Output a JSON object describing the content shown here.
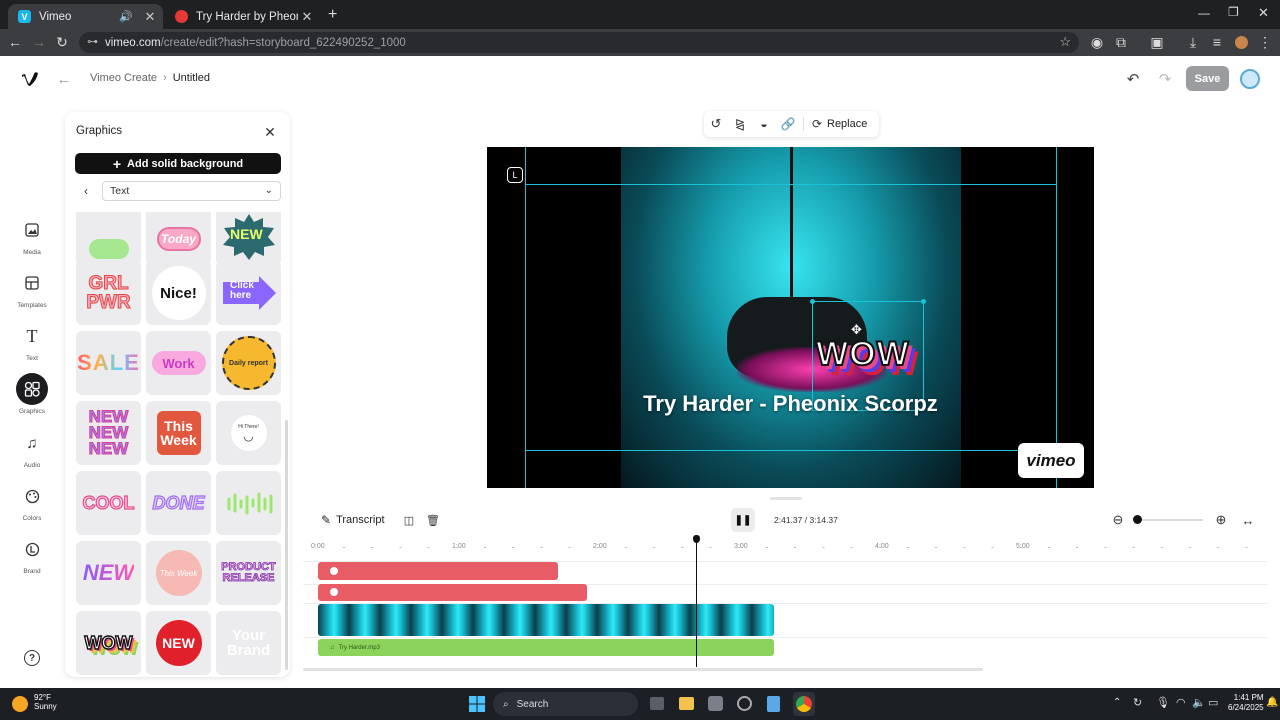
{
  "browser": {
    "tabs": [
      {
        "title": "Vimeo",
        "icon": "vimeo-favicon",
        "active": true
      },
      {
        "title": "Try Harder by Pheonix_Variety |",
        "icon": "youtube-favicon",
        "active": false
      }
    ],
    "url_host": "vimeo.com",
    "url_path": "/create/edit?hash=storyboard_622490252_1000"
  },
  "app": {
    "breadcrumb_root": "Vimeo Create",
    "breadcrumb_current": "Untitled",
    "save_label": "Save"
  },
  "rail": {
    "items": [
      {
        "label": "Media",
        "icon": "image-icon"
      },
      {
        "label": "Templates",
        "icon": "templates-icon"
      },
      {
        "label": "Text",
        "icon": "text-icon"
      },
      {
        "label": "Graphics",
        "icon": "graphics-icon",
        "active": true
      },
      {
        "label": "Audio",
        "icon": "music-note-icon"
      },
      {
        "label": "Colors",
        "icon": "palette-icon"
      },
      {
        "label": "Brand",
        "icon": "brand-icon"
      }
    ]
  },
  "panel": {
    "title": "Graphics",
    "add_bg_label": "Add solid background",
    "category": "Text",
    "stickers": [
      {
        "text": "",
        "name": "sticker-green-partial"
      },
      {
        "text": "Today",
        "name": "sticker-today"
      },
      {
        "text": "NEW",
        "name": "sticker-new-burst"
      },
      {
        "text": "GRL PWR",
        "name": "sticker-grl-pwr"
      },
      {
        "text": "Nice!",
        "name": "sticker-nice"
      },
      {
        "text": "Click here",
        "name": "sticker-click-here"
      },
      {
        "text": "SALE",
        "name": "sticker-sale"
      },
      {
        "text": "Work",
        "name": "sticker-work"
      },
      {
        "text": "Daily report",
        "name": "sticker-daily-report"
      },
      {
        "text": "NEW NEW NEW",
        "name": "sticker-new-new-new"
      },
      {
        "text": "This Week",
        "name": "sticker-this-week"
      },
      {
        "text": "Hi There!",
        "name": "sticker-hi-there"
      },
      {
        "text": "COOL",
        "name": "sticker-cool"
      },
      {
        "text": "DONE",
        "name": "sticker-done"
      },
      {
        "text": "",
        "name": "sticker-wave"
      },
      {
        "text": "NEW",
        "name": "sticker-new-script"
      },
      {
        "text": "This Week",
        "name": "sticker-this-week-circle"
      },
      {
        "text": "PRODUCT RELEASE",
        "name": "sticker-product-release"
      },
      {
        "text": "WOW",
        "name": "sticker-wow"
      },
      {
        "text": "NEW",
        "name": "sticker-new-red"
      },
      {
        "text": "Your Brand",
        "name": "sticker-your-brand"
      }
    ]
  },
  "canvas": {
    "replace_label": "Replace",
    "video_title": "Try Harder - Pheonix Scorpz",
    "sticker_text": "WOW",
    "watermark": "vimeo"
  },
  "timeline": {
    "transcript_label": "Transcript",
    "current_time": "2:41.37",
    "total_time": "3:14.37",
    "ruler": [
      "0:00",
      "1:00",
      "2:00",
      "3:00",
      "4:00",
      "5:00"
    ],
    "audio_label": "Try Harder.mp3",
    "zoom_fraction": 0.0
  },
  "taskbar": {
    "weather_temp": "92°F",
    "weather_desc": "Sunny",
    "search_label": "Search",
    "time": "1:41 PM",
    "date": "6/24/2025"
  },
  "colors": {
    "accent_teal": "#19c3d6",
    "track_red": "#e85c66",
    "track_green": "#8bd35b"
  }
}
